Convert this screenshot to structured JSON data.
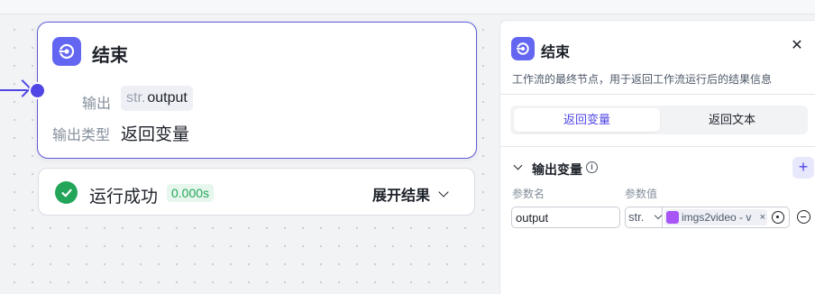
{
  "node": {
    "title": "结束",
    "output_label": "输出",
    "output_prefix": "str.",
    "output_name": "output",
    "type_label": "输出类型",
    "type_value": "返回变量"
  },
  "run": {
    "status_text": "运行成功",
    "duration": "0.000s",
    "expand_label": "展开结果"
  },
  "panel": {
    "title": "结束",
    "close_label": "✕",
    "description": "工作流的最终节点，用于返回工作流运行后的结果信息",
    "tabs": [
      {
        "label": "返回变量",
        "active": true
      },
      {
        "label": "返回文本",
        "active": false
      }
    ],
    "section_title": "输出变量",
    "info_glyph": "i",
    "add_label": "+",
    "columns": {
      "name": "参数名",
      "value": "参数值"
    },
    "row": {
      "name": "output",
      "type": "str.",
      "reference": "imgs2video - v",
      "reference_close": "×"
    }
  },
  "colors": {
    "accent": "#4f46e5",
    "node_icon": "#6366f1",
    "success": "#22a559",
    "reference_icon": "#a855f7"
  },
  "icons": {
    "node": "end-node-icon",
    "check": "check-circle-icon",
    "close": "close-icon",
    "info": "info-icon",
    "add": "plus-icon",
    "reference": "cube-icon",
    "target": "target-icon",
    "remove": "minus-circle-icon"
  }
}
